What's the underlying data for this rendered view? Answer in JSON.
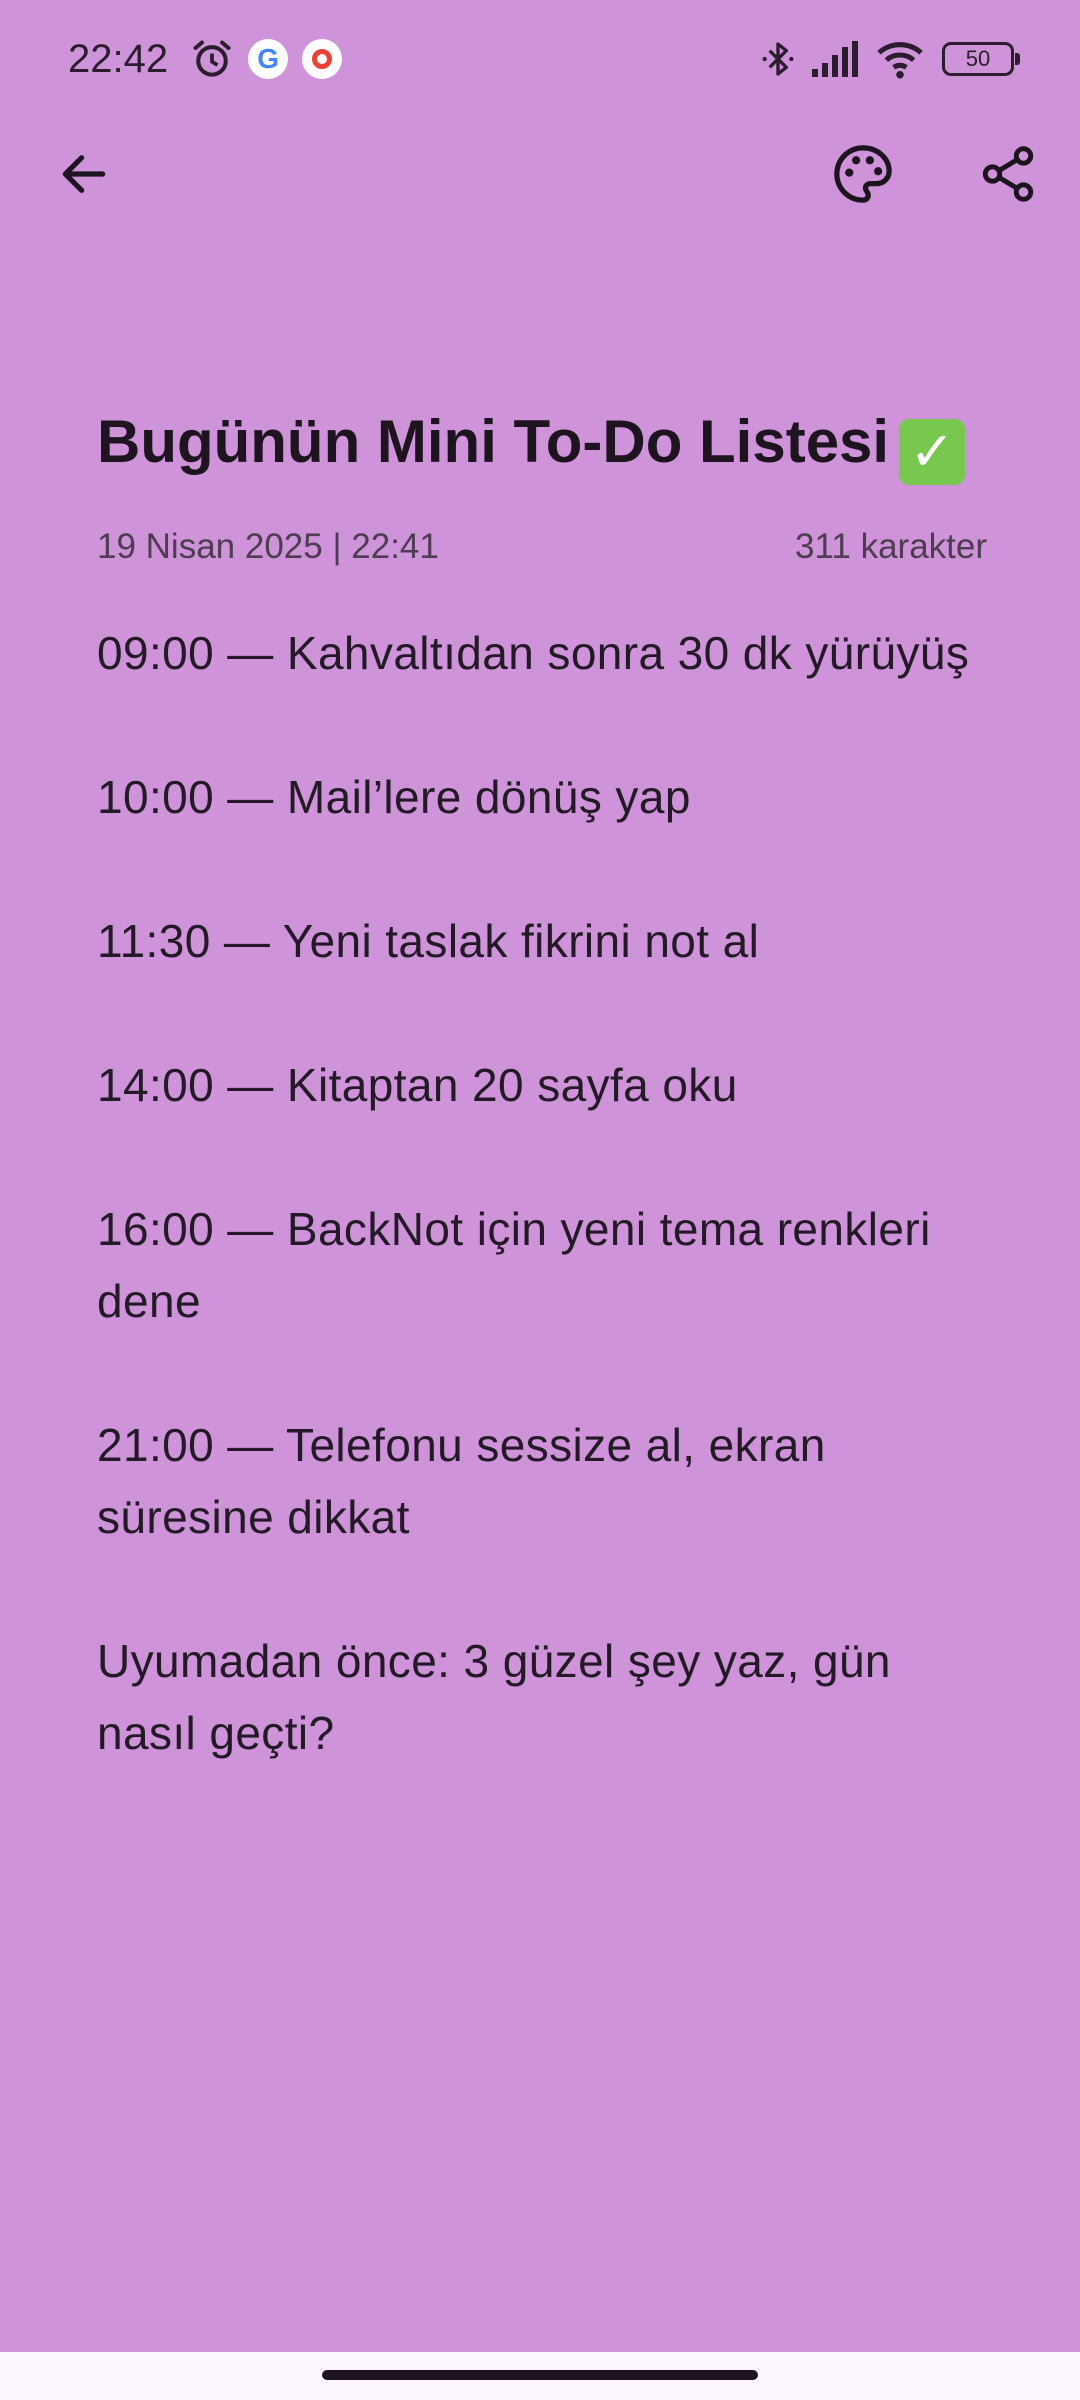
{
  "status_bar": {
    "time": "22:42",
    "google_letter": "G",
    "battery_level": "50"
  },
  "app_bar": {
    "back_icon": "arrow-back-icon",
    "palette_icon": "palette-icon",
    "share_icon": "share-icon"
  },
  "note": {
    "title": "Bugünün Mini To-Do Listesi",
    "title_emoji": "✓",
    "date": "19 Nisan 2025 | 22:41",
    "char_count": "311 karakter",
    "lines": [
      "09:00 — Kahvaltıdan sonra 30 dk yürüyüş",
      "10:00 — Mail’lere dönüş yap",
      "11:30 — Yeni taslak fikrini not al",
      "14:00 — Kitaptan 20 sayfa oku",
      "16:00 — BackNot için yeni tema renkleri dene",
      "21:00 — Telefonu sessize al, ekran süresine dikkat",
      "Uyumadan önce: 3 güzel şey yaz, gün nasıl geçti?"
    ]
  },
  "colors": {
    "background": "#CE93D8",
    "text": "#241a27",
    "nav_bar": "#fdf5ff"
  }
}
